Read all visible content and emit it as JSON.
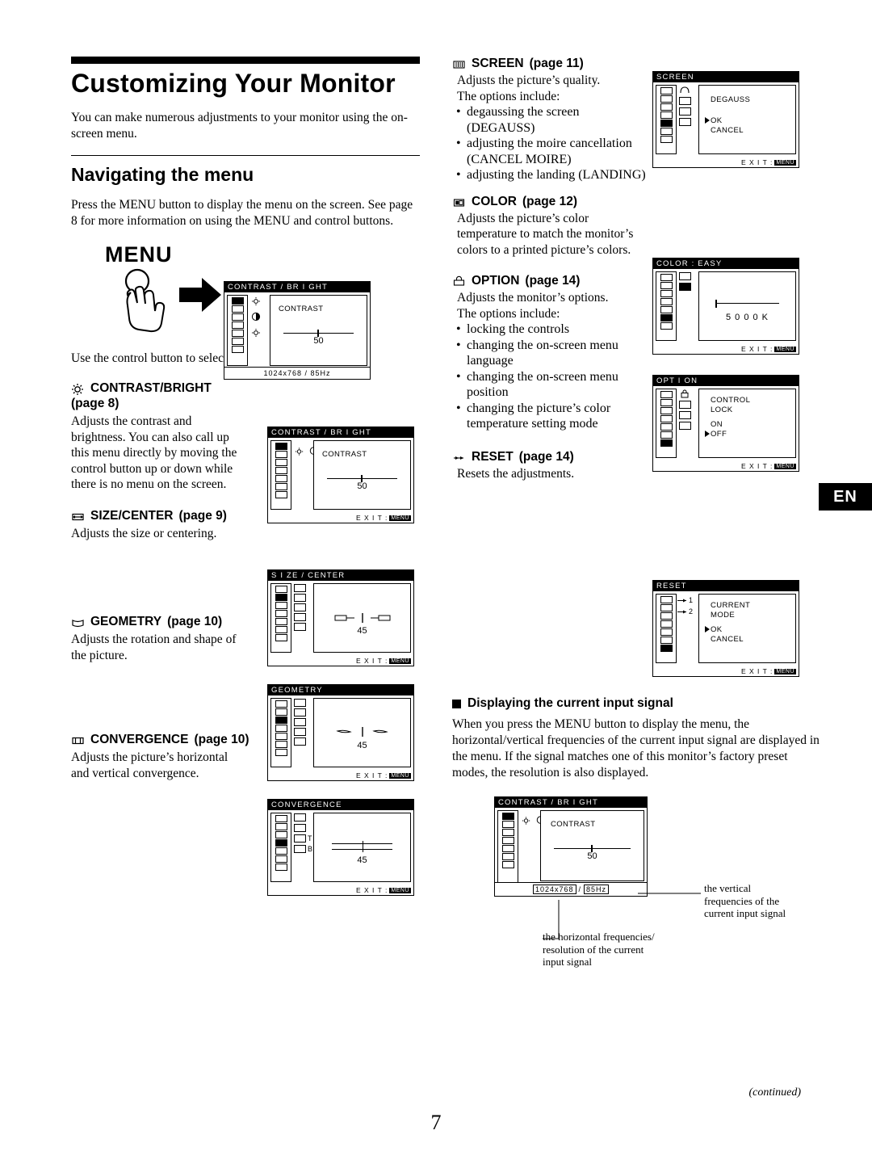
{
  "page": {
    "number": "7",
    "continued": "(continued)",
    "lang_tab": "EN"
  },
  "title": "Customizing Your Monitor",
  "intro": "You can make numerous adjustments to your monitor using the on-screen menu.",
  "section_nav": {
    "heading": "Navigating the menu",
    "para": "Press the MENU button to display the menu on the screen. See page 8 for more information on using the MENU and control buttons.",
    "menu_word": "MENU",
    "after_illus": "Use the control button to select one of the following menus."
  },
  "left_items": [
    {
      "icon": "contrast-bright-icon",
      "title": "CONTRAST/BRIGHT",
      "page": "(page 8)",
      "body": "Adjusts the contrast and brightness. You can also call up this menu directly by moving the control button up or down while there is no menu on the screen."
    },
    {
      "icon": "size-center-icon",
      "title": "SIZE/CENTER",
      "page": "(page 9)",
      "body": "Adjusts the size or centering."
    },
    {
      "icon": "geometry-icon",
      "title": "GEOMETRY",
      "page": "(page 10)",
      "body": "Adjusts the rotation and shape of the picture."
    },
    {
      "icon": "convergence-icon",
      "title": "CONVERGENCE",
      "page": "(page 10)",
      "body": "Adjusts the picture’s horizontal and vertical convergence."
    }
  ],
  "right_items": [
    {
      "icon": "screen-icon",
      "title": "SCREEN",
      "page": "(page 11)",
      "body": "Adjusts the picture’s quality.",
      "body2": "The options include:",
      "bullets": [
        "degaussing the screen (DEGAUSS)",
        "adjusting the moire cancellation (CANCEL MOIRE)",
        "adjusting the landing (LANDING)"
      ]
    },
    {
      "icon": "color-icon",
      "title": "COLOR",
      "page": "(page 12)",
      "body": "Adjusts the picture’s color temperature to match the monitor’s colors to a printed picture’s colors.",
      "bullets": []
    },
    {
      "icon": "option-icon",
      "title": "OPTION",
      "page": "(page 14)",
      "body": "Adjusts the monitor’s options.",
      "body2": "The options include:",
      "bullets": [
        "locking the controls",
        "changing the on-screen menu language",
        "changing the on-screen menu position",
        "changing the picture’s color temperature setting mode"
      ]
    },
    {
      "icon": "reset-icon",
      "title": "RESET",
      "page": "(page 14)",
      "body": "Resets the adjustments.",
      "bullets": []
    }
  ],
  "bottom": {
    "heading": "Displaying the current input signal",
    "para": "When you press the MENU button to display the menu, the horizontal/vertical frequencies of the current input signal are displayed in the menu. If the signal matches one of this monitor’s factory preset modes, the resolution is also displayed.",
    "callout_vertical": "the vertical frequencies of the current input signal",
    "callout_horizontal": "the horizontal frequencies/ resolution of the current input signal"
  },
  "osd": {
    "exit_label": "E X I T :",
    "exit_key": "MENU",
    "contrast_menu": {
      "title": "CONTRAST / BR I GHT",
      "label": "CONTRAST",
      "value": "50",
      "resolution": "1024x768 /   85Hz"
    },
    "contrast_menu2": {
      "title": "CONTRAST / BR I GHT",
      "label": "CONTRAST",
      "value": "50"
    },
    "size_center": {
      "title": "S I ZE / CENTER",
      "value": "45"
    },
    "geometry": {
      "title": "GEOMETRY",
      "value": "45"
    },
    "convergence": {
      "title": "CONVERGENCE",
      "value": "45",
      "row_t": "T",
      "row_b": "B"
    },
    "screen": {
      "title": "SCREEN",
      "item1": "DEGAUSS",
      "item2": "OK",
      "item3": "CANCEL"
    },
    "color": {
      "title": "COLOR    : EASY",
      "value": "5 0 0 0 K"
    },
    "option": {
      "title": "OPT I ON",
      "item1": "CONTROL",
      "item2": "LOCK",
      "item3": "ON",
      "item4": "OFF"
    },
    "reset": {
      "title": "RESET",
      "item1": "CURRENT",
      "item2": "MODE",
      "item3": "OK",
      "item4": "CANCEL",
      "n1": "1",
      "n2": "2"
    },
    "signal_menu": {
      "title": "CONTRAST / BR I GHT",
      "label": "CONTRAST",
      "value": "50",
      "res_left": "1024x768",
      "res_sep": "/",
      "res_right": "85Hz"
    }
  }
}
